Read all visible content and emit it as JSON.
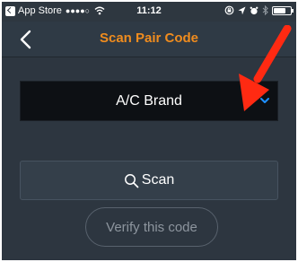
{
  "status_bar": {
    "carrier": "App Store",
    "signal": "●●●●○",
    "time": "11:12"
  },
  "nav": {
    "title": "Scan Pair Code"
  },
  "brand_select": {
    "value": "A/C Brand"
  },
  "scan_button": {
    "label": "Scan"
  },
  "verify_button": {
    "label": "Verify this code"
  },
  "colors": {
    "accent": "#f08c1e",
    "chevron": "#1e90ff",
    "annotation": "#ff2a12",
    "background": "#2e3740"
  },
  "icons": [
    "back-to-app-icon",
    "wifi-icon",
    "orientation-lock-icon",
    "location-icon",
    "alarm-icon",
    "bluetooth-icon",
    "battery-icon",
    "back-chevron-icon",
    "chevron-down-icon",
    "search-icon",
    "red-arrow-icon"
  ]
}
